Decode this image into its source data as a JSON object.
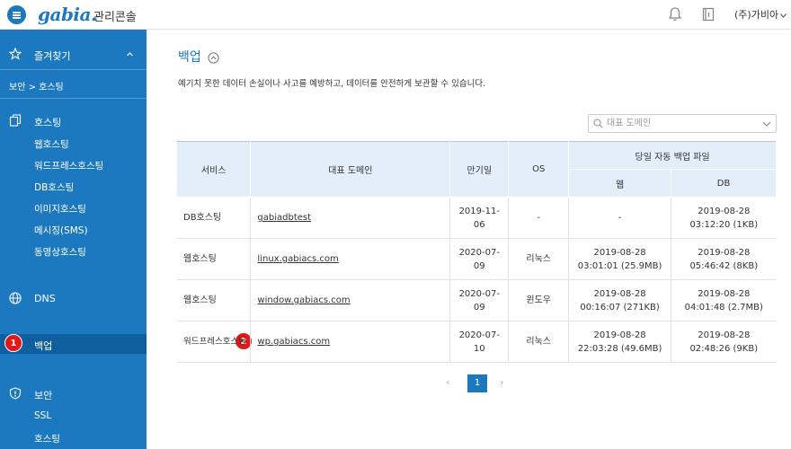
{
  "header": {
    "logo": "gabia.",
    "console_title": "관리콘솔",
    "account": "(주)가비아"
  },
  "sidebar": {
    "favorites_label": "즐겨찾기",
    "breadcrumb": "보안 > 호스팅",
    "hosting_label": "호스팅",
    "hosting_items": [
      "웹호스팅",
      "워드프레스호스팅",
      "DB호스팅",
      "이미지호스팅",
      "메시징(SMS)",
      "동영상호스팅"
    ],
    "dns_label": "DNS",
    "backup_label": "백업",
    "security_label": "보안",
    "security_items": [
      "SSL",
      "호스팅"
    ]
  },
  "markers": {
    "one": "1",
    "two": "2"
  },
  "main": {
    "title": "백업",
    "description": "예기치 못한 데이터 손실이나 사고를 예방하고, 데이터를 안전하게 보관할 수 있습니다.",
    "search_placeholder": "대표 도메인"
  },
  "table": {
    "headers": {
      "service": "서비스",
      "domain": "대표 도메인",
      "expiry": "만기일",
      "os": "OS",
      "daily_backup": "당일 자동 백업 파일",
      "web": "웹",
      "db": "DB"
    },
    "rows": [
      {
        "service": "DB호스팅",
        "domain": "gabiadbtest",
        "expiry_a": "2019-11-",
        "expiry_b": "06",
        "os": "-",
        "web_a": "-",
        "web_b": "",
        "db_a": "2019-08-28",
        "db_b": "03:12:20 (1KB)"
      },
      {
        "service": "웹호스팅",
        "domain": "linux.gabiacs.com",
        "expiry_a": "2020-07-",
        "expiry_b": "09",
        "os": "리눅스",
        "web_a": "2019-08-28",
        "web_b": "03:01:01 (25.9MB)",
        "db_a": "2019-08-28",
        "db_b": "05:46:42 (8KB)"
      },
      {
        "service": "웹호스팅",
        "domain": "window.gabiacs.com",
        "expiry_a": "2020-07-",
        "expiry_b": "09",
        "os": "윈도우",
        "web_a": "2019-08-28",
        "web_b": "00:16:07 (271KB)",
        "db_a": "2019-08-28",
        "db_b": "04:01:48 (2.7MB)"
      },
      {
        "service": "워드프레스호스팅",
        "domain": "wp.gabiacs.com",
        "expiry_a": "2020-07-",
        "expiry_b": "10",
        "os": "리눅스",
        "web_a": "2019-08-28",
        "web_b": "22:03:28 (49.6MB)",
        "db_a": "2019-08-28",
        "db_b": "02:48:26 (9KB)"
      }
    ]
  },
  "pagination": {
    "prev": "‹",
    "current": "1",
    "next": "›"
  }
}
